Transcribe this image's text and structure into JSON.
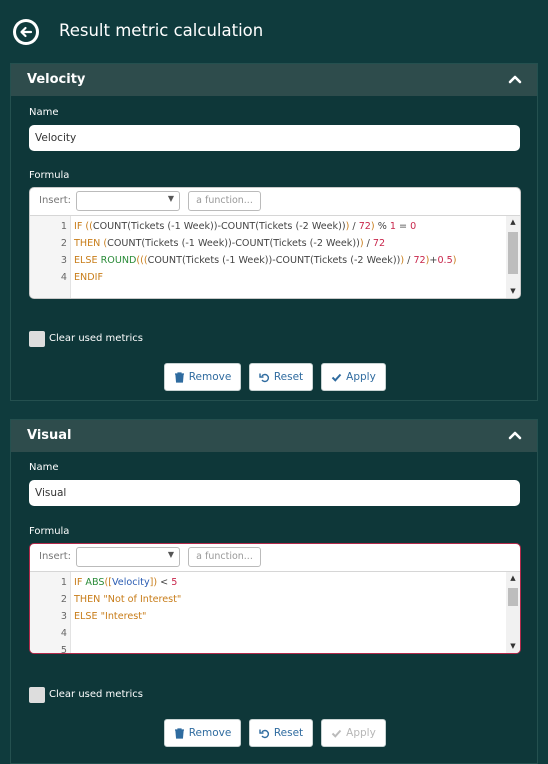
{
  "header": {
    "title": "Result metric calculation"
  },
  "panels": [
    {
      "title": "Velocity",
      "name_label": "Name",
      "name_value": "Velocity",
      "formula_label": "Formula",
      "insert_label": "Insert:",
      "insert_value": "",
      "function_placeholder": "a function...",
      "code_lines": [
        [
          {
            "t": "kw",
            "v": "IF "
          },
          {
            "t": "paren",
            "v": "(("
          },
          {
            "t": "txt",
            "v": "COUNT(Tickets (-1 Week))-COUNT(Tickets (-2 Week))"
          },
          {
            "t": "paren",
            "v": ")"
          },
          {
            "t": "txt",
            "v": " / "
          },
          {
            "t": "num",
            "v": "72"
          },
          {
            "t": "paren",
            "v": ")"
          },
          {
            "t": "txt",
            "v": " % "
          },
          {
            "t": "num",
            "v": "1"
          },
          {
            "t": "txt",
            "v": " = "
          },
          {
            "t": "num",
            "v": "0"
          }
        ],
        [
          {
            "t": "kw",
            "v": "THEN "
          },
          {
            "t": "paren",
            "v": "("
          },
          {
            "t": "txt",
            "v": "COUNT(Tickets (-1 Week))-COUNT(Tickets (-2 Week))"
          },
          {
            "t": "paren",
            "v": ")"
          },
          {
            "t": "txt",
            "v": " / "
          },
          {
            "t": "num",
            "v": "72"
          }
        ],
        [
          {
            "t": "kw",
            "v": "ELSE "
          },
          {
            "t": "fn",
            "v": "ROUND"
          },
          {
            "t": "paren",
            "v": "((("
          },
          {
            "t": "txt",
            "v": "COUNT(Tickets (-1 Week))-COUNT(Tickets (-2 Week))"
          },
          {
            "t": "paren",
            "v": ")"
          },
          {
            "t": "txt",
            "v": " / "
          },
          {
            "t": "num",
            "v": "72"
          },
          {
            "t": "paren",
            "v": ")"
          },
          {
            "t": "txt",
            "v": "+"
          },
          {
            "t": "num",
            "v": "0.5"
          },
          {
            "t": "paren",
            "v": ")"
          }
        ],
        [
          {
            "t": "kw",
            "v": "ENDIF"
          }
        ]
      ],
      "line_numbers": [
        "1",
        "2",
        "3",
        "4"
      ],
      "clear_label": "Clear used metrics",
      "buttons": {
        "remove": "Remove",
        "reset": "Reset",
        "apply": "Apply"
      },
      "apply_enabled": true,
      "invalid": false
    },
    {
      "title": "Visual",
      "name_label": "Name",
      "name_value": "Visual",
      "formula_label": "Formula",
      "insert_label": "Insert:",
      "insert_value": "",
      "function_placeholder": "a function...",
      "code_lines": [
        [
          {
            "t": "kw",
            "v": "IF "
          },
          {
            "t": "fn",
            "v": "ABS"
          },
          {
            "t": "paren",
            "v": "(["
          },
          {
            "t": "var",
            "v": "Velocity"
          },
          {
            "t": "paren",
            "v": "])"
          },
          {
            "t": "txt",
            "v": " < "
          },
          {
            "t": "num",
            "v": "5"
          }
        ],
        [
          {
            "t": "kw",
            "v": "THEN "
          },
          {
            "t": "str",
            "v": "\"Not of Interest\""
          }
        ],
        [
          {
            "t": "kw",
            "v": "ELSE "
          },
          {
            "t": "str",
            "v": "\"Interest\""
          }
        ],
        [],
        []
      ],
      "line_numbers": [
        "1",
        "2",
        "3",
        "4",
        "5"
      ],
      "clear_label": "Clear used metrics",
      "buttons": {
        "remove": "Remove",
        "reset": "Reset",
        "apply": "Apply"
      },
      "apply_enabled": false,
      "invalid": true
    }
  ],
  "colors": {
    "background": "#0f3b3d",
    "panel_header": "#2e4c4c",
    "button_text": "#2f6b9f",
    "invalid_border": "#b3294a"
  },
  "icons": {
    "back": "arrow-left-circle-icon",
    "collapse": "chevron-up-icon",
    "remove": "trash-icon",
    "reset": "undo-icon",
    "apply": "check-icon"
  }
}
